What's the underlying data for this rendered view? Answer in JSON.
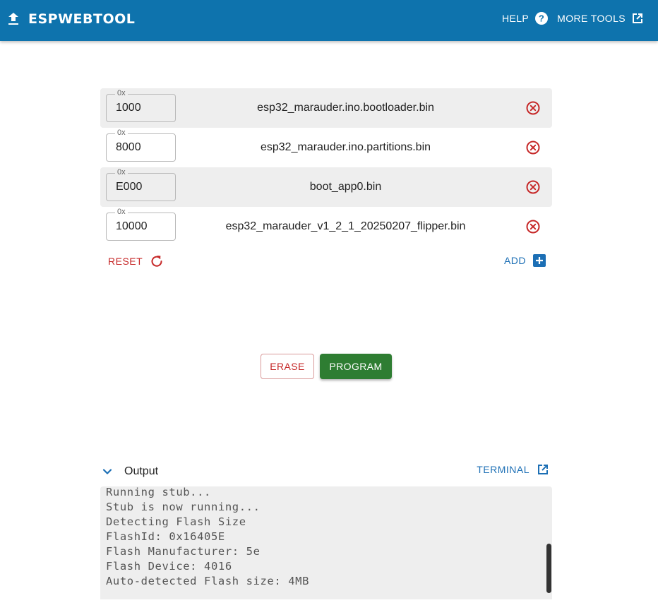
{
  "header": {
    "title": "ESPWEBTOOL",
    "help_label": "HELP",
    "more_tools_label": "MORE TOOLS",
    "bg_color": "#0e73ad"
  },
  "files": [
    {
      "offset_prefix": "0x",
      "offset": "1000",
      "filename": "esp32_marauder.ino.bootloader.bin"
    },
    {
      "offset_prefix": "0x",
      "offset": "8000",
      "filename": "esp32_marauder.ino.partitions.bin"
    },
    {
      "offset_prefix": "0x",
      "offset": "E000",
      "filename": "boot_app0.bin"
    },
    {
      "offset_prefix": "0x",
      "offset": "10000",
      "filename": "esp32_marauder_v1_2_1_20250207_flipper.bin"
    }
  ],
  "actions": {
    "reset_label": "RESET",
    "add_label": "ADD",
    "erase_label": "ERASE",
    "program_label": "PROGRAM"
  },
  "output": {
    "title": "Output",
    "terminal_label": "TERMINAL",
    "lines": [
      "Running stub...",
      "Stub is now running...",
      "Detecting Flash Size",
      "FlashId: 0x16405E",
      "Flash Manufacturer: 5e",
      "Flash Device: 4016",
      "Auto-detected Flash size: 4MB"
    ]
  },
  "colors": {
    "danger": "#c62828",
    "primary": "#1c6fb5",
    "success": "#2e7d32"
  },
  "icons": {
    "upload": "upload-icon",
    "help": "help-circle-icon",
    "external": "open-in-new-icon",
    "remove": "close-circle-icon",
    "reset": "refresh-icon",
    "add": "add-box-icon",
    "chevron": "chevron-down-icon"
  }
}
